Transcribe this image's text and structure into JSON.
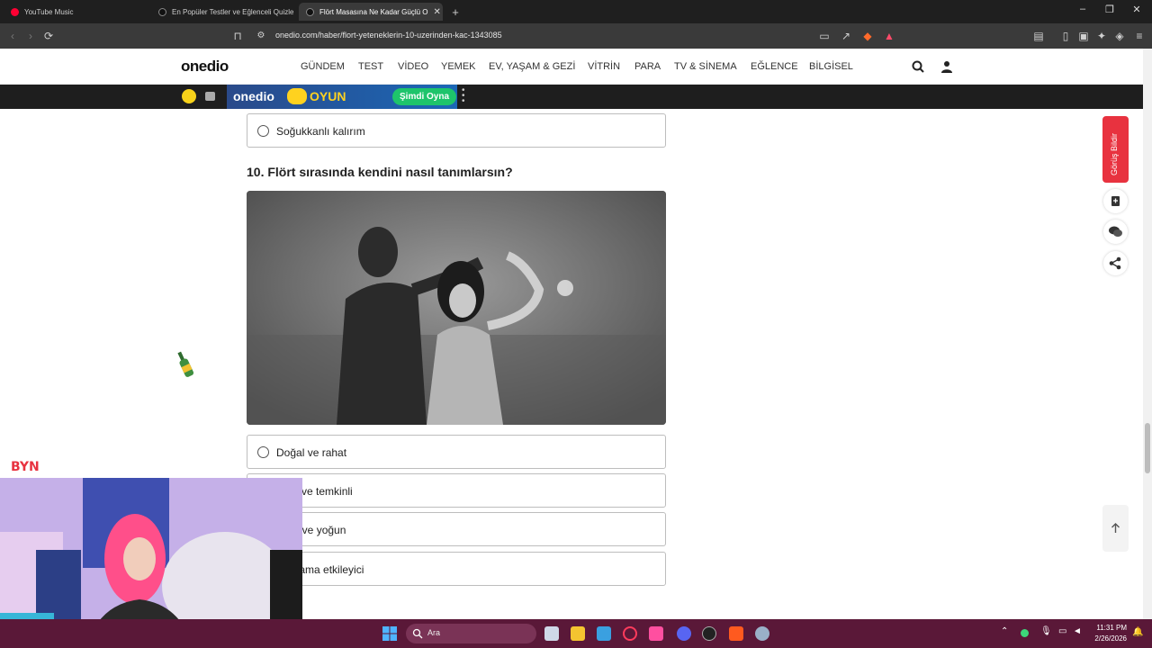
{
  "browser": {
    "tabs": [
      {
        "label": "YouTube Music",
        "favicon_color": "#ff0033"
      },
      {
        "label": "En Popüler Testler ve Eğlenceli Quizle",
        "favicon_color": "#111111"
      },
      {
        "label": "Flört Masasına Ne Kadar Güçlü O",
        "favicon_color": "#111111"
      }
    ],
    "new_tab": "+",
    "url": "onedio.com/haber/flort-yeteneklerin-10-uzerinden-kac-1343085",
    "window_controls": {
      "minimize": "–",
      "maximize": "❐",
      "close": "✕"
    }
  },
  "site": {
    "logo": "onedio",
    "nav": [
      "GÜNDEM",
      "TEST",
      "VİDEO",
      "YEMEK",
      "EV, YAŞAM & GEZİ",
      "VİTRİN",
      "PARA",
      "TV & SİNEMA",
      "EĞLENCE",
      "BİLGİSEL"
    ],
    "game_bar": {
      "logo": "onedio",
      "label": "OYUN",
      "cta": "Şimdi Oyna"
    }
  },
  "quiz": {
    "prev_option": "Soğukkanlı kalırım",
    "question": "10. Flört sırasında kendini nasıl tanımlarsın?",
    "options": [
      "Doğal ve rahat",
      "nceli ve temkinli",
      "canlı ve yoğun",
      "efeli ama etkileyici"
    ]
  },
  "side_tools": {
    "feedback": "Görüş Bildir"
  },
  "webcam_overlay_text": "BYN",
  "taskbar": {
    "search_placeholder": "Ara",
    "time": "11:31 PM",
    "date": "2/26/2026"
  },
  "colors": {
    "accent_red": "#e8323f",
    "taskbar": "#5a1838",
    "cta_green": "#1ec46b",
    "oyun_yellow": "#ffd21f"
  }
}
